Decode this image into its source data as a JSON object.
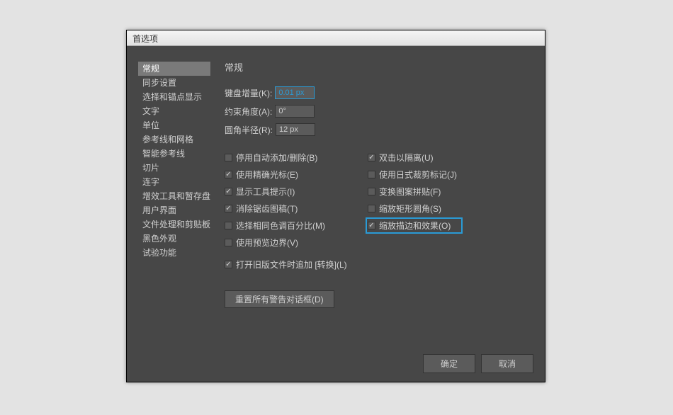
{
  "window": {
    "title": "首选项"
  },
  "sidebar": {
    "items": [
      {
        "label": "常规",
        "active": true
      },
      {
        "label": "同步设置"
      },
      {
        "label": "选择和锚点显示"
      },
      {
        "label": "文字"
      },
      {
        "label": "单位"
      },
      {
        "label": "参考线和网格"
      },
      {
        "label": "智能参考线"
      },
      {
        "label": "切片"
      },
      {
        "label": "连字"
      },
      {
        "label": "增效工具和暂存盘"
      },
      {
        "label": "用户界面"
      },
      {
        "label": "文件处理和剪贴板"
      },
      {
        "label": "黑色外观"
      },
      {
        "label": "试验功能"
      }
    ]
  },
  "content": {
    "title": "常规",
    "fields": {
      "keyboard_increment": {
        "label": "键盘增量(K):",
        "value": "0.01 px",
        "highlight": true
      },
      "constraint_angle": {
        "label": "约束角度(A):",
        "value": "0°"
      },
      "corner_radius": {
        "label": "圆角半径(R):",
        "value": "12 px"
      }
    },
    "checkboxes_left": [
      {
        "label": "停用自动添加/删除(B)",
        "checked": false
      },
      {
        "label": "使用精确光标(E)",
        "checked": true
      },
      {
        "label": "显示工具提示(I)",
        "checked": true
      },
      {
        "label": "消除锯齿图稿(T)",
        "checked": true
      },
      {
        "label": "选择相同色调百分比(M)",
        "checked": false
      },
      {
        "label": "使用预览边界(V)",
        "checked": false
      }
    ],
    "checkboxes_right": [
      {
        "label": "双击以隔离(U)",
        "checked": true
      },
      {
        "label": "使用日式裁剪标记(J)",
        "checked": false
      },
      {
        "label": "变换图案拼贴(F)",
        "checked": false
      },
      {
        "label": "缩放矩形圆角(S)",
        "checked": false
      },
      {
        "label": "缩放描边和效果(O)",
        "checked": true,
        "highlighted": true
      }
    ],
    "transform_legacy": {
      "label": "打开旧版文件时追加 [转换](L)",
      "checked": true
    },
    "reset_button": "重置所有警告对话框(D)"
  },
  "footer": {
    "ok": "确定",
    "cancel": "取消"
  }
}
